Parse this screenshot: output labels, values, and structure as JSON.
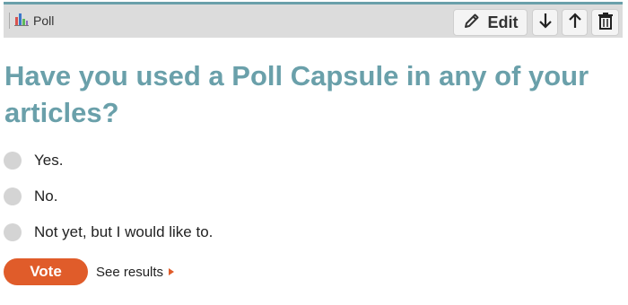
{
  "toolbar": {
    "capsule_label": "Poll",
    "capsule_icon": "bar-chart-icon",
    "edit_label": "Edit",
    "edit_icon": "pencil-icon",
    "move_down_icon": "arrow-down-icon",
    "move_up_icon": "arrow-up-icon",
    "delete_icon": "trash-icon",
    "accent_color": "#6aa0aa"
  },
  "poll": {
    "question": "Have you used a Poll Capsule in any of your articles?",
    "options": [
      {
        "label": "Yes."
      },
      {
        "label": "No."
      },
      {
        "label": "Not yet, but I would like to."
      }
    ],
    "vote_label": "Vote",
    "see_results_label": "See results",
    "question_color": "#6aa0aa",
    "button_color": "#e05c2a"
  }
}
